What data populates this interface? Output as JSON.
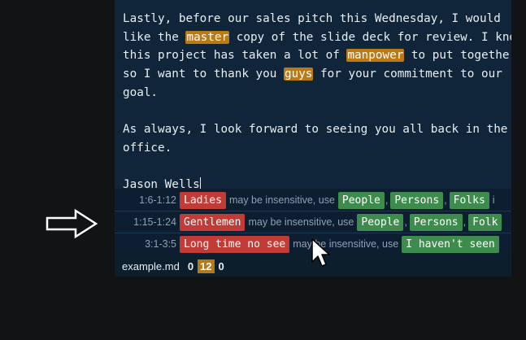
{
  "editor": {
    "lines": [
      [
        {
          "t": "Lastly, before our sales pitch this Wednesday, I would"
        }
      ],
      [
        {
          "t": "like the "
        },
        {
          "t": "master",
          "h": true
        },
        {
          "t": " copy of the slide deck for review. I know"
        }
      ],
      [
        {
          "t": "this project has taken a lot of "
        },
        {
          "t": "manpower",
          "h": true
        },
        {
          "t": " to put together,"
        }
      ],
      [
        {
          "t": "so I want to thank you "
        },
        {
          "t": "guys",
          "h": true
        },
        {
          "t": " for your commitment to our"
        }
      ],
      [
        {
          "t": "goal."
        }
      ],
      [
        {
          "t": ""
        }
      ],
      [
        {
          "t": "As always, I look forward to seeing you all back in the"
        }
      ],
      [
        {
          "t": "office."
        }
      ],
      [
        {
          "t": ""
        }
      ],
      [
        {
          "t": "Jason Wells",
          "caret": true
        }
      ]
    ]
  },
  "warnings": [
    {
      "position": "1:6-1:12",
      "term": "Ladies",
      "message": "may be insensitive, use",
      "suggestions": [
        "People",
        "Persons",
        "Folks"
      ],
      "overflow": "i"
    },
    {
      "position": "1:15-1:24",
      "term": "Gentlemen",
      "message": "may be insensitive, use",
      "suggestions": [
        "People",
        "Persons",
        "Folk"
      ],
      "overflow": ""
    },
    {
      "position": "3:1-3:5",
      "term": "Long time no see",
      "message": "may be insensitive, use",
      "suggestions": [
        "I haven't seen"
      ],
      "overflow": ""
    }
  ],
  "status": {
    "filename": "example.md",
    "errors": "0",
    "warnings": "12",
    "infos": "0"
  },
  "icons": {
    "side_arrow": "right-arrow-icon",
    "cursor": "mouse-pointer-icon"
  },
  "colors": {
    "editor_bg": "#10253a",
    "highlight": "#bb7a15",
    "bad_chip": "#c23b37",
    "good_chip": "#3e8c4d",
    "warning_count": "#b27a1c"
  }
}
